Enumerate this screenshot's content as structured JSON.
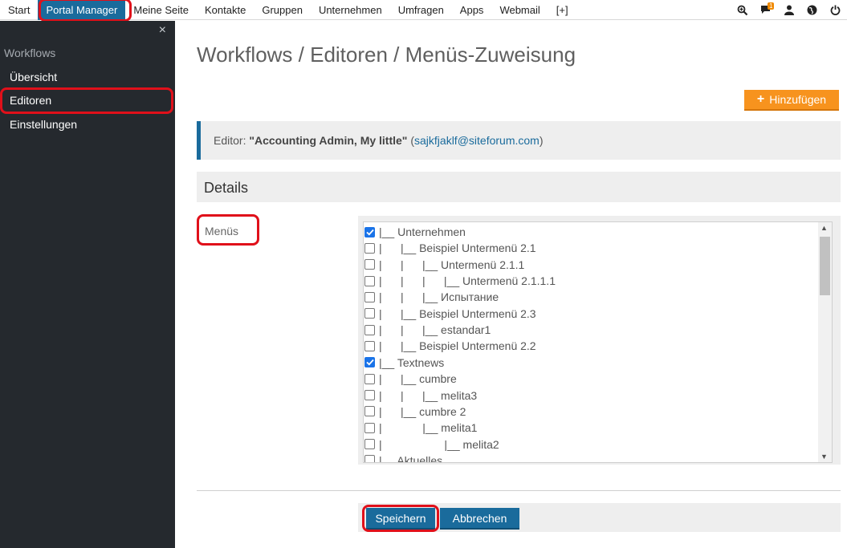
{
  "topnav": {
    "items": [
      "Start",
      "Portal Manager",
      "Meine Seite",
      "Kontakte",
      "Gruppen",
      "Unternehmen",
      "Umfragen",
      "Apps",
      "Webmail",
      "[+]"
    ],
    "active": "Portal Manager",
    "icons": [
      "zoom-in-icon",
      "chat-icon",
      "user-icon",
      "globe-icon",
      "power-icon"
    ],
    "notification_count": "1"
  },
  "sidebar": {
    "close": "×",
    "section_title": "Workflows",
    "items": [
      "Übersicht",
      "Editoren",
      "Einstellungen"
    ],
    "active": "Editoren"
  },
  "main": {
    "title": "Workflows / Editoren / Menüs-Zuweisung",
    "add_button": "Hinzufügen",
    "info": {
      "prefix": "Editor: ",
      "name": "\"Accounting Admin, My little\"",
      "open": " (",
      "email": "sajkfjaklf@siteforum.com",
      "close": ")"
    },
    "details_heading": "Details",
    "menus_label": "Menüs",
    "menu_tree": [
      {
        "text": "|__ Unternehmen",
        "checked": true
      },
      {
        "text": "|      |__ Beispiel Untermenü 2.1",
        "checked": false
      },
      {
        "text": "|      |      |__ Untermenü 2.1.1",
        "checked": false
      },
      {
        "text": "|      |      |      |__ Untermenü 2.1.1.1",
        "checked": false
      },
      {
        "text": "|      |      |__ Испытание",
        "checked": false
      },
      {
        "text": "|      |__ Beispiel Untermenü 2.3",
        "checked": false
      },
      {
        "text": "|      |      |__ estandar1",
        "checked": false
      },
      {
        "text": "|      |__ Beispiel Untermenü 2.2",
        "checked": false
      },
      {
        "text": "|__ Textnews",
        "checked": true
      },
      {
        "text": "|      |__ cumbre",
        "checked": false
      },
      {
        "text": "|      |      |__ melita3",
        "checked": false
      },
      {
        "text": "|      |__ cumbre 2",
        "checked": false
      },
      {
        "text": "|             |__ melita1",
        "checked": false
      },
      {
        "text": "|                    |__ melita2",
        "checked": false
      },
      {
        "text": "|__ Aktuelles",
        "checked": false
      }
    ],
    "save_button": "Speichern",
    "cancel_button": "Abbrechen"
  },
  "colors": {
    "accent": "#1a6b9c",
    "add_button": "#f7931e",
    "sidebar_bg": "#25292e",
    "highlight_ring": "#e0101a"
  }
}
